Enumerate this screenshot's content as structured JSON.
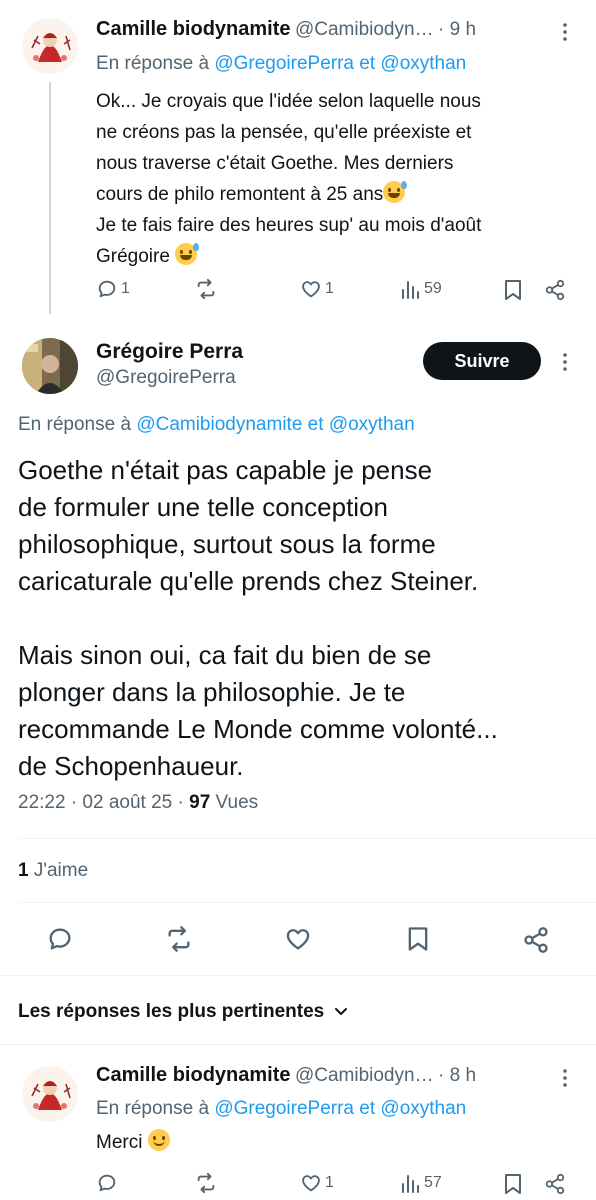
{
  "tweet1": {
    "name": "Camille biodynamite",
    "handle": "@Camibiodyn…",
    "time": "· 9 h",
    "reply_prefix": "En réponse à",
    "reply_user1": "@GregoirePerra",
    "reply_and": "et",
    "reply_user2": "@oxythan",
    "lines": [
      "Ok... Je croyais que l'idée selon laquelle nous",
      "ne créons pas la pensée,  qu'elle préexiste et",
      "nous traverse c'était Goethe. Mes derniers",
      "cours de philo remontent à 25 ans",
      "Je te fais faire des heures sup' au mois d'août",
      "Grégoire "
    ],
    "replies": "1",
    "likes": "1",
    "views": "59"
  },
  "main": {
    "name": "Grégoire Perra",
    "handle": "@GregoirePerra",
    "follow_label": "Suivre",
    "reply_prefix": "En réponse à",
    "reply_user1": "@Camibiodynamite",
    "reply_and": "et",
    "reply_user2": "@oxythan",
    "lines": [
      "Goethe n'était pas capable je pense",
      "de formuler une telle conception",
      "philosophique, surtout sous la forme",
      "caricaturale qu'elle prends chez Steiner.",
      "",
      "Mais sinon oui, ca fait du bien de se",
      "plonger dans la philosophie. Je te",
      "recommande Le Monde comme volonté...",
      "de Schopenhaueur."
    ],
    "timestamp": "22:22 · 02 août 25 ·",
    "views_count": "97",
    "views_label": "Vues",
    "likes_count": "1",
    "likes_label": "J'aime"
  },
  "sort": {
    "label": "Les réponses les plus pertinentes"
  },
  "tweet3": {
    "name": "Camille biodynamite",
    "handle": "@Camibiodyn…",
    "time": "· 8 h",
    "reply_prefix": "En réponse à",
    "reply_user1": "@GregoirePerra",
    "reply_and": "et",
    "reply_user2": "@oxythan",
    "text": "Merci ",
    "likes": "1",
    "views": "57"
  }
}
